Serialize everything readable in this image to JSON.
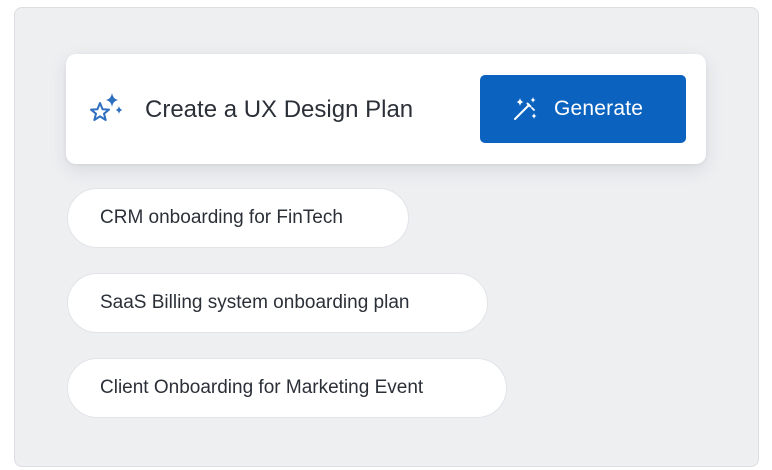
{
  "prompt": {
    "text": "Create a UX Design Plan",
    "icon": "sparkle-stars-icon"
  },
  "generate_button": {
    "label": "Generate",
    "icon": "magic-wand-icon"
  },
  "suggestions": [
    {
      "label": "CRM onboarding for FinTech"
    },
    {
      "label": "SaaS Billing system onboarding plan"
    },
    {
      "label": "Client Onboarding for Marketing Event"
    }
  ],
  "colors": {
    "accent": "#0c63bf",
    "panel_background": "#eeeff1",
    "card_background": "#ffffff",
    "text": "#2b3038",
    "icon_stroke": "#2f6fc0"
  }
}
